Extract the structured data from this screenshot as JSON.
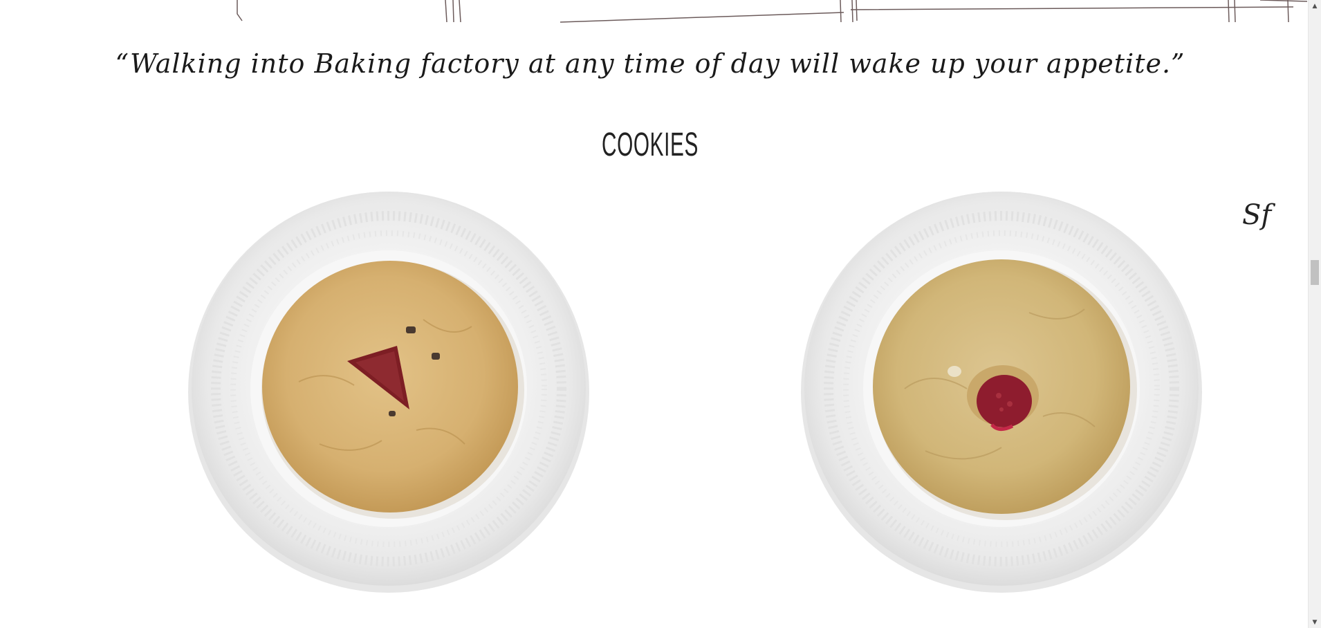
{
  "quote": "“Walking into Baking factory at any time of day will wake up your appetite.”",
  "section_title": "COOKIES",
  "logo_mark": "Sf",
  "products": [
    {
      "name": "strawberry-chocolate-chip-cookie",
      "filling_color": "#7d1e24"
    },
    {
      "name": "raspberry-white-chocolate-cookie",
      "filling_color": "#8e1c2e"
    }
  ],
  "colors": {
    "background": "#ffffff",
    "sketch_line": "#6b5a5a",
    "plate": "#f2f2f2",
    "cookie": "#d8b577"
  },
  "scrollbar": {
    "up_icon": "▲",
    "down_icon": "▼"
  }
}
